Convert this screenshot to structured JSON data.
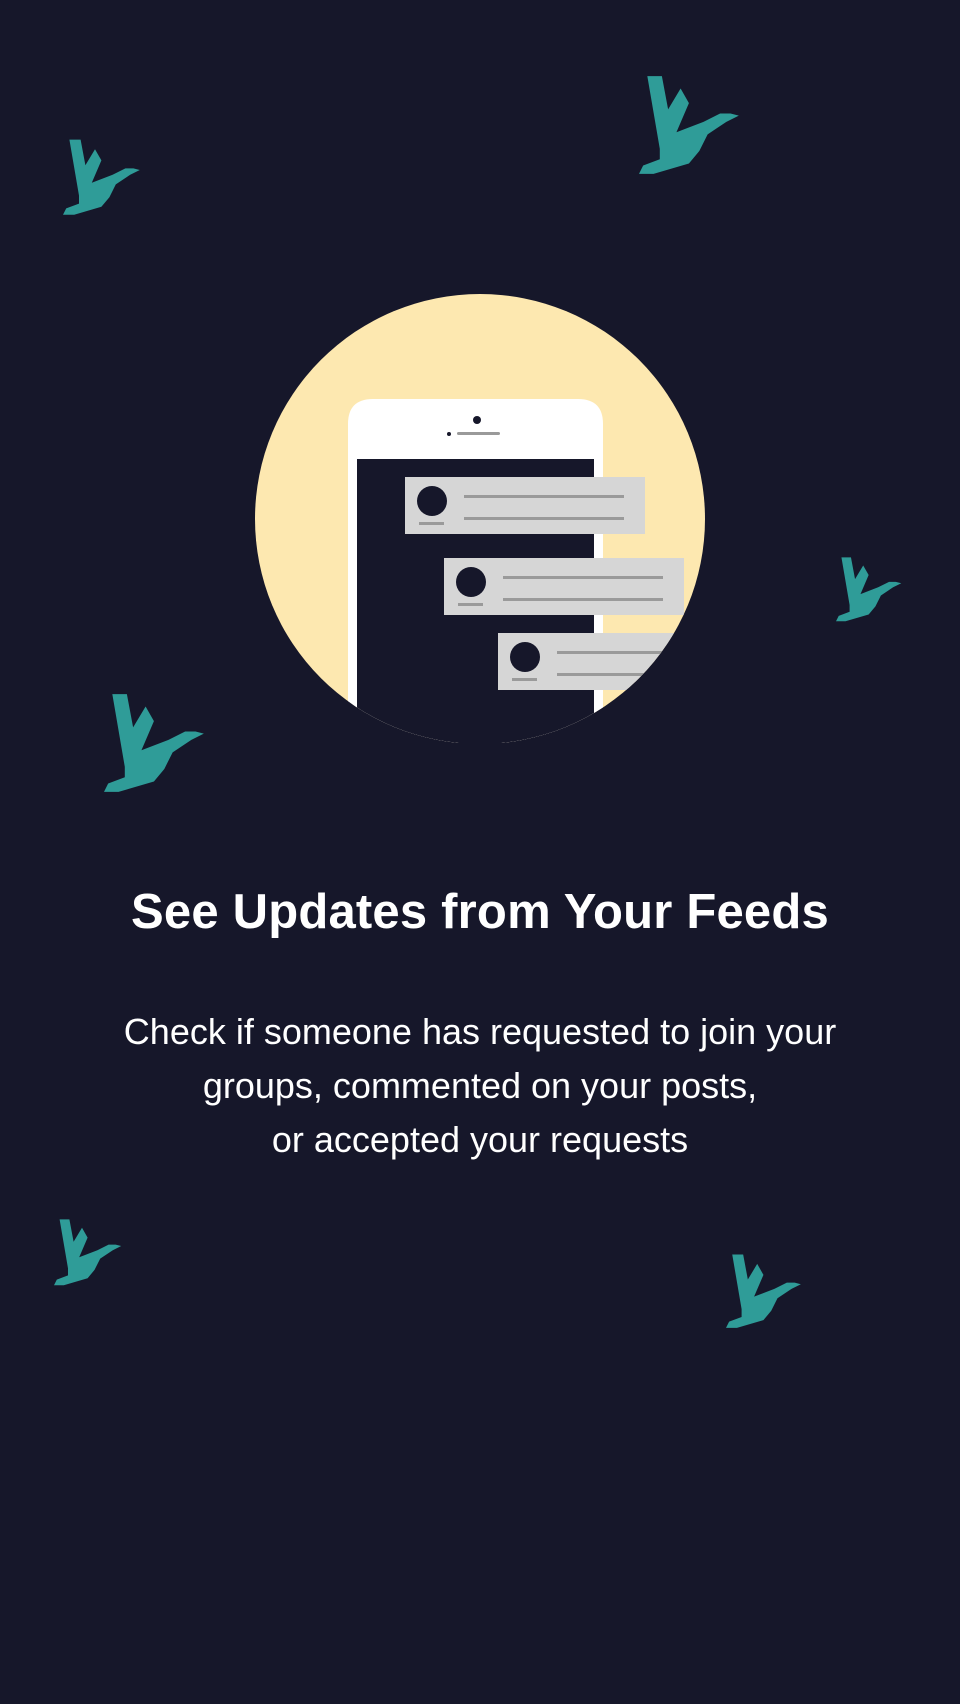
{
  "onboarding": {
    "title": "See Updates from Your Feeds",
    "description_lines": [
      "Check if someone has requested to join your",
      "groups, commented on your posts,",
      "or accepted your requests"
    ]
  },
  "colors": {
    "background": "#16172a",
    "bird": "#2f9c98",
    "moon": "#fde8b0",
    "phone": "#ffffff",
    "phone_screen": "#16172a",
    "notification_card": "#d6d6d6",
    "notification_line": "#9a9a9a",
    "avatar": "#16172a",
    "text": "#ffffff"
  },
  "icons": {
    "bird": "flying-bird-icon",
    "phone": "smartphone-icon",
    "notification": "notification-card-icon"
  }
}
